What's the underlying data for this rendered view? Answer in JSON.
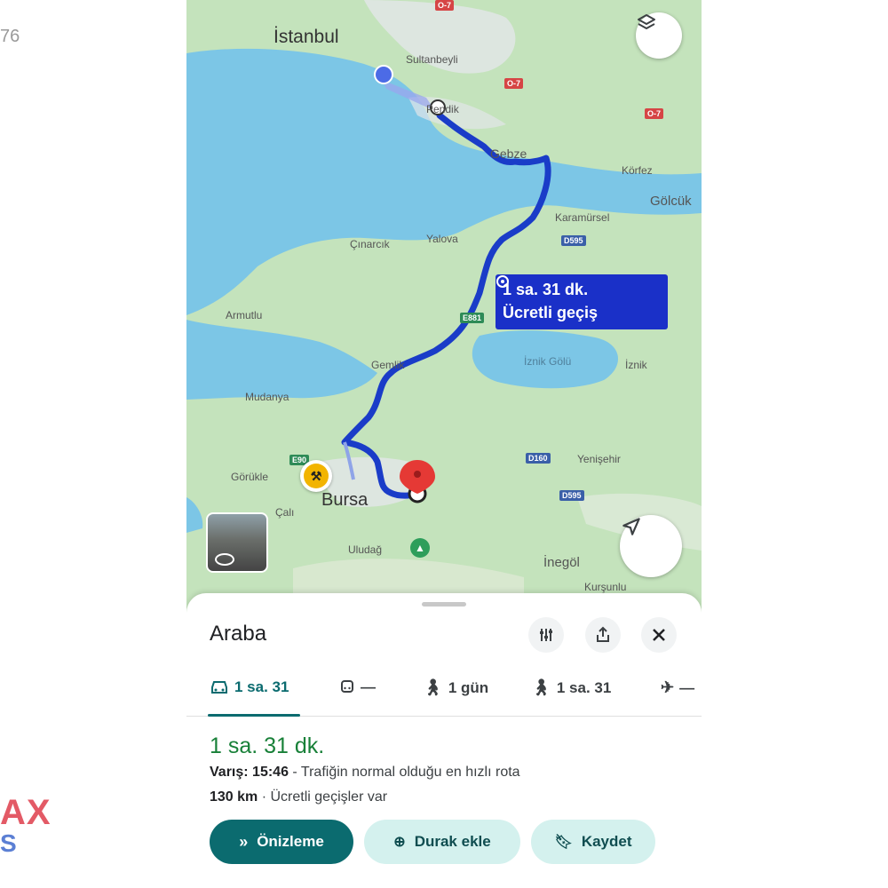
{
  "edge": {
    "number": "76",
    "brand_top": "AX",
    "brand_bottom": "S"
  },
  "map": {
    "cities": {
      "istanbul": "İstanbul",
      "bursa": "Bursa"
    },
    "towns": {
      "sultanbeyli": "Sultanbeyli",
      "pendik": "Pendik",
      "gebze": "Gebze",
      "korfez": "Körfez",
      "golcuk": "Gölcük",
      "karamursel": "Karamürsel",
      "cinarcik": "Çınarcık",
      "yalova": "Yalova",
      "armutlu": "Armutlu",
      "gemlik": "Gemlik",
      "mudanya": "Mudanya",
      "iznik": "İznik",
      "yenisehir": "Yenişehir",
      "gorukle": "Görükle",
      "cali": "Çalı",
      "uludag": "Uludağ",
      "inegol": "İnegöl",
      "kursunlu": "Kurşunlu"
    },
    "lake": "İznik Gölü",
    "shields": {
      "o7a": "O-7",
      "o7b": "O-7",
      "o7c": "O-7",
      "d595a": "D595",
      "d595b": "D595",
      "d160": "D160",
      "e881": "E881",
      "e90": "E90"
    },
    "route_box": {
      "time": "1 sa. 31 dk.",
      "toll": "Ücretli geçiş"
    }
  },
  "sheet": {
    "title": "Araba",
    "tabs": [
      {
        "icon": "car-icon",
        "label": "1 sa. 31"
      },
      {
        "icon": "transit-icon",
        "label": "—"
      },
      {
        "icon": "walk-icon",
        "label": "1 gün"
      },
      {
        "icon": "hike-icon",
        "label": "1 sa. 31"
      },
      {
        "icon": "flight-icon",
        "label": "—"
      }
    ],
    "duration": "1 sa. 31 dk.",
    "arrival_label": "Varış:",
    "arrival_time": "15:46",
    "arrival_desc": "- Trafiğin normal olduğu en hızlı rota",
    "distance": "130 km",
    "toll_text": "· Ücretli geçişler var",
    "buttons": {
      "preview": "Önizleme",
      "add_stop": "Durak ekle",
      "save": "Kaydet"
    }
  },
  "colors": {
    "accent": "#0b6b6f",
    "route": "#1a30c8",
    "duration": "#188038",
    "water": "#7cc6e6",
    "land": "#bfe0b8"
  }
}
